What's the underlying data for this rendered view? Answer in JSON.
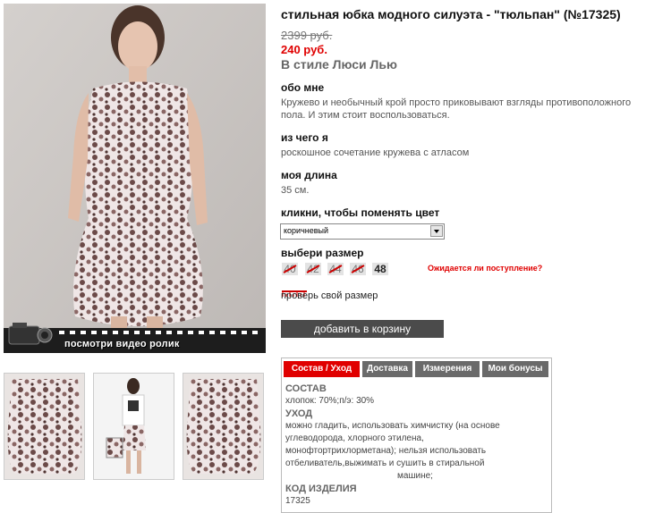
{
  "product": {
    "title": "стильная юбка модного силуэта - \"тюльпан\" (№17325)",
    "old_price": "2399 руб.",
    "new_price": "240 руб.",
    "brand": "В стиле Люси Лью"
  },
  "about": {
    "heading": "обо мне",
    "text_line1": "Кружево и необычный крой просто приковывают взгляды противоположного",
    "text_line2": "пола. И этим стоит воспользоваться."
  },
  "material": {
    "heading": "из чего я",
    "text": "роскошное сочетание кружева с атласом"
  },
  "length": {
    "heading": "моя длина",
    "text": "35 см."
  },
  "color": {
    "heading": "кликни, чтобы поменять цвет",
    "selected": "коричневый"
  },
  "sizes": {
    "heading": "выбери размер",
    "items": [
      "40",
      "42",
      "44",
      "46",
      "48"
    ],
    "waiting": "Ожидается ли поступление?",
    "check_size": "проверь свой размер"
  },
  "video": {
    "label": "посмотри видео ролик"
  },
  "cart": {
    "label": "добавить в корзину"
  },
  "tabs": {
    "items": [
      "Состав / Уход",
      "Доставка",
      "Измерения",
      "Мои бонусы"
    ],
    "content": {
      "composition_label": "СОСТАВ",
      "composition": "хлопок: 70%;п/э: 30%",
      "care_label": "УХОД",
      "care_line1": "можно гладить, использовать химчистку (на основе",
      "care_line2": "углеводорода, хлорного этилена,",
      "care_line3": "монофтортрихлорметана); нельзя использовать",
      "care_line4": "отбеливатель,выжимать и сушить в стиральной",
      "care_line5": "машине;",
      "code_label": "КОД ИЗДЕЛИЯ",
      "code": "17325"
    }
  },
  "colors": {
    "accent": "#e00000",
    "button": "#4b4b4b",
    "tab": "#6a6a6a"
  }
}
